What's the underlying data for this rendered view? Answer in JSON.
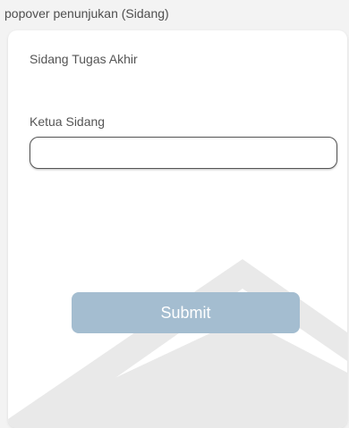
{
  "frame": {
    "title": "popover penunjukan (Sidang)"
  },
  "card": {
    "title": "Sidang Tugas Akhir",
    "field": {
      "label": "Ketua Sidang",
      "value": "",
      "placeholder": ""
    },
    "submit_label": "Submit"
  },
  "colors": {
    "background": "#f3f3f3",
    "card": "#ffffff",
    "button": "#a4bdd0",
    "button_text": "#ffffff",
    "watermark": "#e8e8e8"
  },
  "watermark_icon": "building-logo-watermark"
}
